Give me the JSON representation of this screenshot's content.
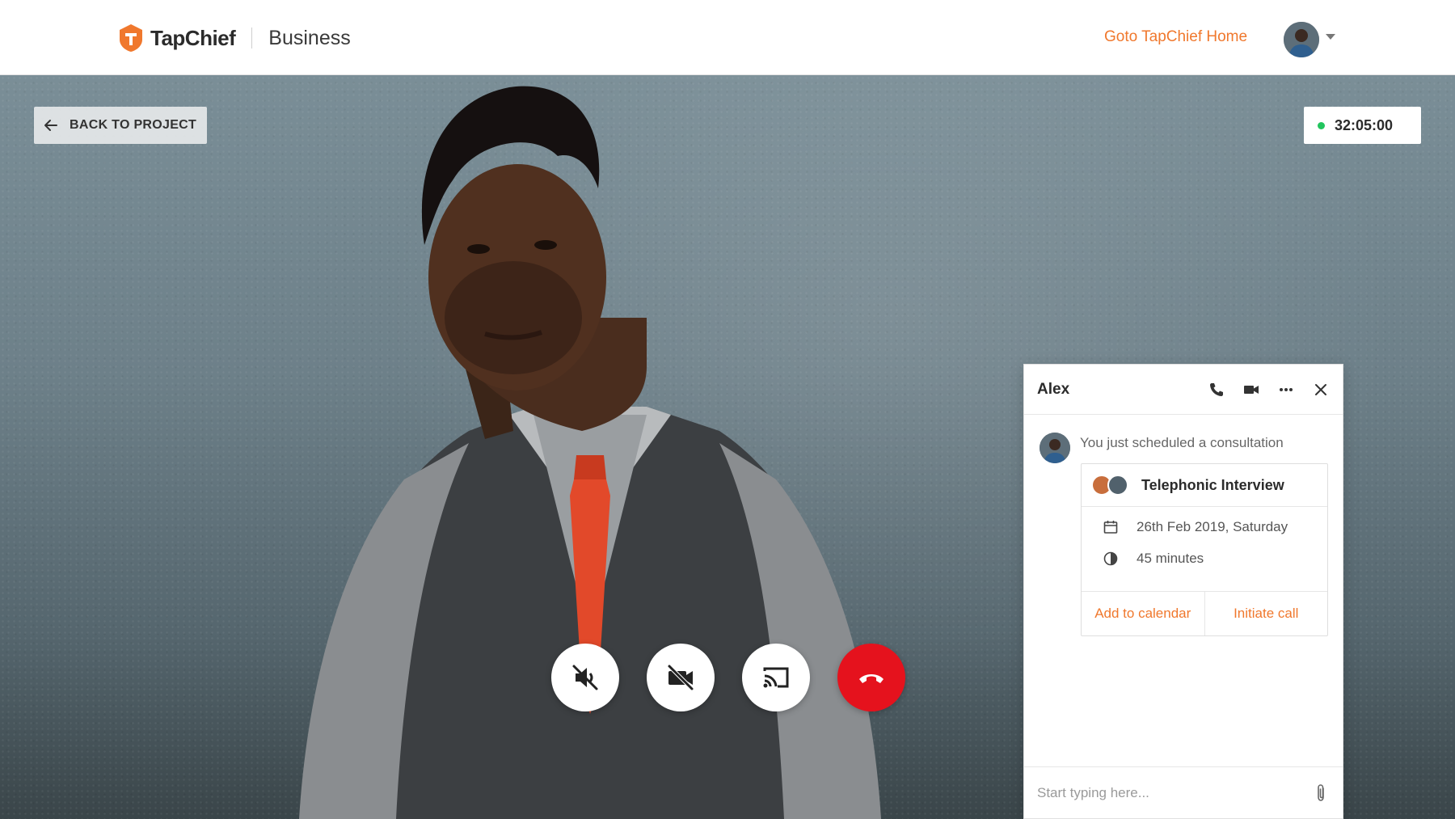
{
  "header": {
    "brand_name": "TapChief",
    "brand_sub": "Business",
    "home_link": "Goto TapChief Home",
    "brand_color": "#f0782d"
  },
  "stage": {
    "back_label": "BACK TO PROJECT",
    "timer": "32:05:00",
    "live_color": "#22c55e",
    "controls": [
      {
        "name": "mute-button",
        "icon": "speaker-muted-icon"
      },
      {
        "name": "video-off-button",
        "icon": "video-off-icon"
      },
      {
        "name": "cast-button",
        "icon": "cast-icon"
      },
      {
        "name": "end-call-button",
        "icon": "hang-up-icon",
        "color": "#e5121d"
      }
    ]
  },
  "chat": {
    "name": "Alex",
    "header_icons": [
      "phone-icon",
      "video-camera-icon",
      "more-icon",
      "close-icon"
    ],
    "message": "You just scheduled a consultation",
    "card": {
      "title": "Telephonic Interview",
      "date": "26th Feb 2019, Saturday",
      "duration": "45 minutes",
      "add_to_calendar": "Add to calendar",
      "initiate_call": "Initiate call"
    },
    "input_placeholder": "Start typing here..."
  }
}
